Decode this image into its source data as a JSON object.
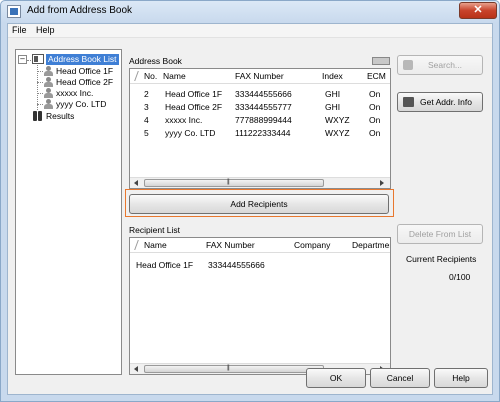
{
  "window": {
    "title": "Add from Address Book",
    "close_label": "✕"
  },
  "menu": [
    "File",
    "Help"
  ],
  "tree": {
    "root": "Address Book List",
    "children": [
      "Head Office 1F",
      "Head Office 2F",
      "xxxxx Inc.",
      "yyyy Co. LTD"
    ],
    "results": "Results"
  },
  "address_book": {
    "label": "Address Book",
    "columns": [
      "No.",
      "Name",
      "FAX Number",
      "Index",
      "ECM"
    ],
    "rows": [
      [
        "2",
        "Head Office 1F",
        "333444555666",
        "GHI",
        "On"
      ],
      [
        "3",
        "Head Office 2F",
        "333444555777",
        "GHI",
        "On"
      ],
      [
        "4",
        "xxxxx Inc.",
        "777888999444",
        "WXYZ",
        "On"
      ],
      [
        "5",
        "yyyy Co. LTD",
        "111222333444",
        "WXYZ",
        "On"
      ]
    ],
    "scroll_grip": "|||"
  },
  "buttons": {
    "search": "Search...",
    "get_addr": "Get Addr. Info",
    "add_recipients": "Add Recipients",
    "delete_from_list": "Delete From List",
    "ok": "OK",
    "cancel": "Cancel",
    "help": "Help"
  },
  "recipient_list": {
    "label": "Recipient List",
    "columns": [
      "Name",
      "FAX Number",
      "Company",
      "Department"
    ],
    "rows": [
      [
        "Head Office 1F",
        "333444555666"
      ]
    ],
    "scroll_grip": "|||"
  },
  "current_recipients": {
    "label": "Current Recipients",
    "value": "0/100"
  }
}
